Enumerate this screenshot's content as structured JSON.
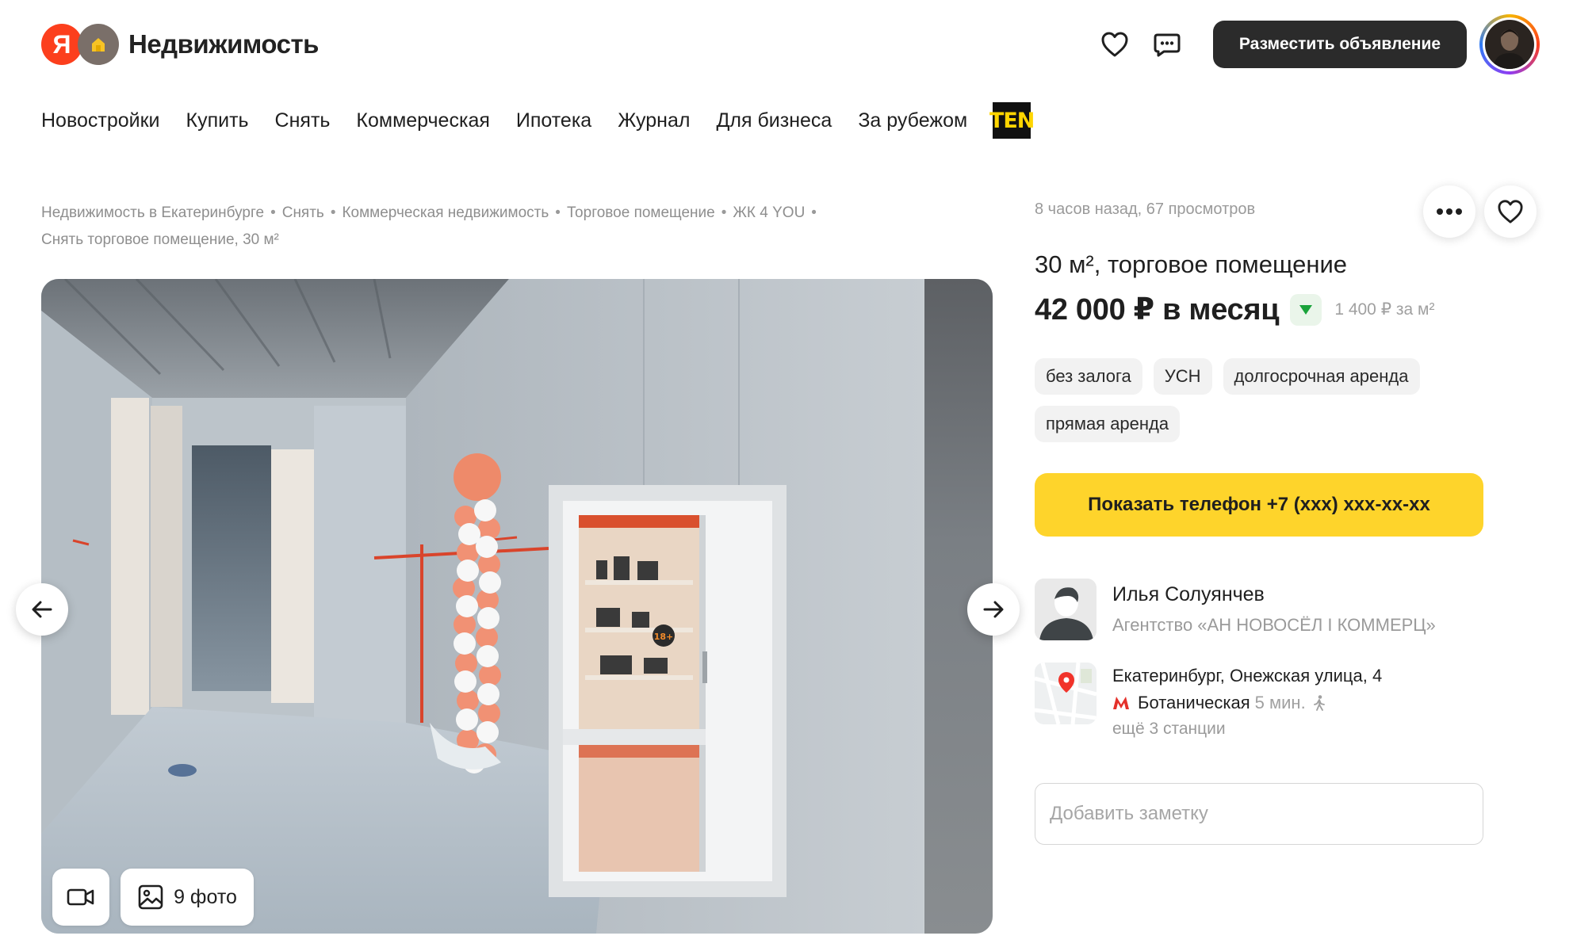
{
  "header": {
    "logo_ya": "Я",
    "logo_text": "Недвижимость",
    "favorites_icon": "heart-icon",
    "chat_icon": "chat-icon",
    "post_button": "Разместить объявление",
    "avatar_icon": "user-avatar"
  },
  "nav": {
    "items": [
      "Новостройки",
      "Купить",
      "Снять",
      "Коммерческая",
      "Ипотека",
      "Журнал",
      "Для бизнеса",
      "За рубежом"
    ],
    "partner_logo": "TEN"
  },
  "breadcrumbs": [
    "Недвижимость в Екатеринбурге",
    "Снять",
    "Коммерческая недвижимость",
    "Торговое помещение",
    "ЖК 4 YOU",
    "Снять торговое помещение, 30 м²"
  ],
  "gallery": {
    "prev_icon": "arrow-left-icon",
    "next_icon": "arrow-right-icon",
    "video_icon": "video-camera-icon",
    "photos_icon": "image-icon",
    "photos_label": "9 фото",
    "sticker": "18+"
  },
  "offer": {
    "meta": "8 часов назад, 67 просмотров",
    "more_icon": "ellipsis-icon",
    "favorite_icon": "heart-icon",
    "title": "30 м², торговое помещение",
    "price": "42 000 ₽ в месяц",
    "price_trend_icon": "price-down-icon",
    "price_per_m2": "1 400 ₽ за м²",
    "tags": [
      "без залога",
      "УСН",
      "долгосрочная аренда",
      "прямая аренда"
    ],
    "phone_button": "Показать телефон +7 (xxx) xxx-xx-xx"
  },
  "agent": {
    "name": "Илья Солуянчев",
    "agency": "Агентство «АН НОВОСЁЛ I КОММЕРЦ»"
  },
  "location": {
    "address": "Екатеринбург, Онежская улица, 4",
    "metro_station": "Ботаническая",
    "metro_time": "5 мин.",
    "walk_icon": "walking-icon",
    "more_stations": "ещё 3 станции"
  },
  "note": {
    "placeholder": "Добавить заметку",
    "value": ""
  },
  "colors": {
    "brand_red": "#fc3f1d",
    "phone_button": "#fed42b",
    "dark_button": "#2b2b2b",
    "metro_red": "#e4312b",
    "price_down": "#1aa33b"
  }
}
